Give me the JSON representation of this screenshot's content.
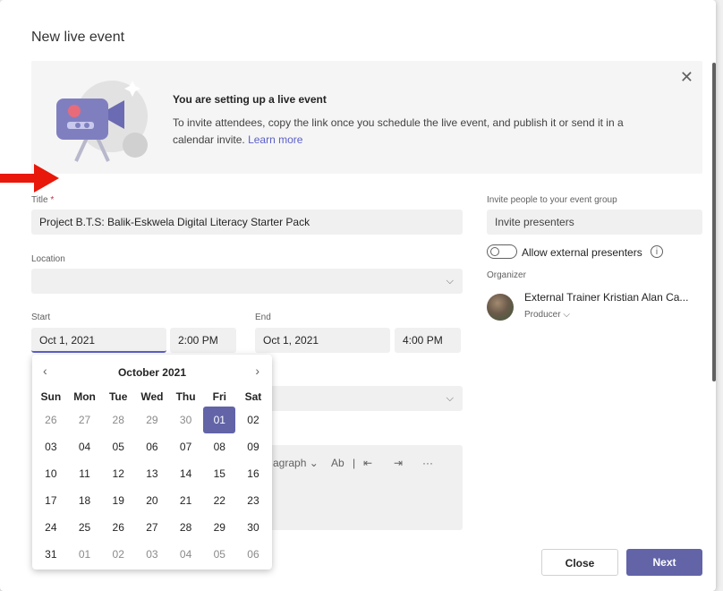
{
  "dialog": {
    "title": "New live event"
  },
  "banner": {
    "heading": "You are setting up a live event",
    "text": "To invite attendees, copy the link once you schedule the live event, and publish it or send it in a calendar invite.",
    "learn_more": "Learn more",
    "close_glyph": "✕"
  },
  "form": {
    "title_label": "Title",
    "title_required": "*",
    "title_value": "Project B.T.S: Balik-Eskwela Digital Literacy Starter Pack",
    "location_label": "Location",
    "location_value": "",
    "start_label": "Start",
    "start_date": "Oct 1, 2021",
    "start_time": "2:00 PM",
    "end_label": "End",
    "end_date": "Oct 1, 2021",
    "end_time": "4:00 PM"
  },
  "invite": {
    "label": "Invite people to your event group",
    "placeholder": "Invite presenters",
    "allow_external": "Allow external presenters",
    "info_glyph": "i",
    "organizer_label": "Organizer",
    "organizer_name": "External Trainer Kristian Alan Ca...",
    "organizer_role": "Producer"
  },
  "toolbar": {
    "paragraph": "agraph",
    "chevron": "⌄",
    "spell": "Ab",
    "sep": "|",
    "outdent": "⇤",
    "indent": "⇥",
    "more": "···"
  },
  "calendar": {
    "month": "October 2021",
    "prev": "‹",
    "next": "›",
    "weekdays": [
      "Sun",
      "Mon",
      "Tue",
      "Wed",
      "Thu",
      "Fri",
      "Sat"
    ],
    "weeks": [
      [
        "26",
        "27",
        "28",
        "29",
        "30",
        "01",
        "02"
      ],
      [
        "03",
        "04",
        "05",
        "06",
        "07",
        "08",
        "09"
      ],
      [
        "10",
        "11",
        "12",
        "13",
        "14",
        "15",
        "16"
      ],
      [
        "17",
        "18",
        "19",
        "20",
        "21",
        "22",
        "23"
      ],
      [
        "24",
        "25",
        "26",
        "27",
        "28",
        "29",
        "30"
      ],
      [
        "31",
        "01",
        "02",
        "03",
        "04",
        "05",
        "06"
      ]
    ],
    "selected": "01"
  },
  "buttons": {
    "close": "Close",
    "next": "Next"
  },
  "colors": {
    "accent": "#6264a7",
    "arrow": "#e8180b"
  }
}
